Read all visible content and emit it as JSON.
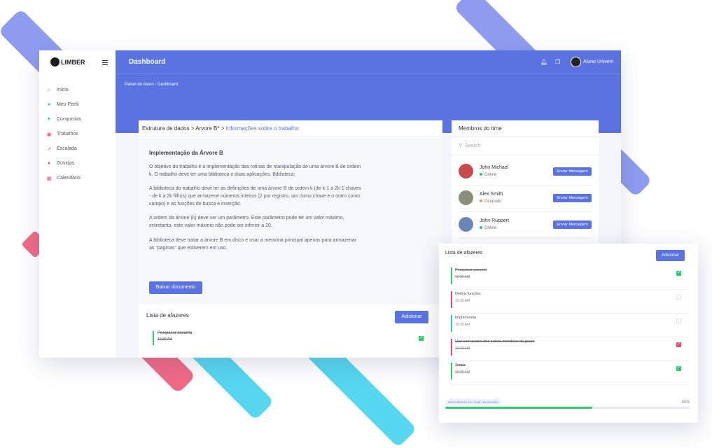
{
  "colors": {
    "primary": "#5b73e0",
    "success": "#2ecc71",
    "danger": "#ef4a6b",
    "busy": "#f39c5a"
  },
  "brand": {
    "logo_text": "LIMBER"
  },
  "sidebar": {
    "items": [
      {
        "label": "Início",
        "icon": "home-icon"
      },
      {
        "label": "Meu Perfil",
        "icon": "user-icon"
      },
      {
        "label": "Conquistas",
        "icon": "trophy-icon"
      },
      {
        "label": "Trabalhos",
        "icon": "briefcase-icon"
      },
      {
        "label": "Escalada",
        "icon": "chart-icon"
      },
      {
        "label": "Dúvidas",
        "icon": "pin-icon"
      },
      {
        "label": "Calendário",
        "icon": "calendar-icon"
      }
    ]
  },
  "header": {
    "title": "Dashboard",
    "user_name": "Aluno Univem",
    "breadcrumb": {
      "root": "Painel do Aluno",
      "sep": "›",
      "current": "Dashboard"
    }
  },
  "main": {
    "breadcrumb": {
      "a": "Estrutura de dados > Arvore B* > ",
      "b": "Informações sobre o trabalho"
    },
    "heading": "Implementação da Árvore B",
    "p1": "O objetivo do trabalho é a implementação das rotinas de manipulação de uma árvore B de ordem k. O trabalho deve ter uma biblioteca e duas aplicações. Biblioteca:",
    "p2": "A biblioteca do trabalho deve ter as definições de uma árvore B de ordem k (de k-1 a 2k-1 chaves - de k a 2k filhos) que armazene números inteiros (2 por registro, um como chave e o outro como campo) e as funções de busca e inserção.",
    "p3": "A ordem da árvore (k) deve ser um parâmetro. Este parâmetro pode ter um valor máximo, entretanto, este valor máximo não pode ser inferior a 20.",
    "p4": "A biblioteca deve tratar a árvore B em disco e usar a memória principal apenas para armazenar as \"páginas\" que estiverem em uso.",
    "download_label": "Baixar documento"
  },
  "todo_left": {
    "title": "Lista de afazeres",
    "add_label": "Adicionar",
    "item_title": "Pesquisar assunto",
    "item_time": "10:30 AM"
  },
  "team": {
    "title": "Membros do time",
    "search_placeholder": "Search",
    "send_label": "Enviar Mensagem",
    "members": [
      {
        "name": "John Michael",
        "status": "Online"
      },
      {
        "name": "Alex Smith",
        "status": "Ocupado"
      },
      {
        "name": "John Ruppert",
        "status": "Online"
      }
    ]
  },
  "todo_float": {
    "title": "Lista de afazeres",
    "add_label": "Adicionar",
    "items": [
      {
        "title": "Pesquisar assunto",
        "time": "10:30 AM",
        "done": true
      },
      {
        "title": "Definir funções",
        "time": "10:30 AM",
        "done": false
      },
      {
        "title": "Implementar",
        "time": "10:30 AM",
        "done": false
      },
      {
        "title": "Unir com partes dos outros membros do grupo",
        "time": "10:30 AM",
        "done": true
      },
      {
        "title": "Testar",
        "time": "10:30 AM",
        "done": true
      }
    ],
    "progress_label": "PROGRESSO DO TIME NA MISSÃO",
    "progress_text": "60%",
    "progress_value": 0.6
  }
}
